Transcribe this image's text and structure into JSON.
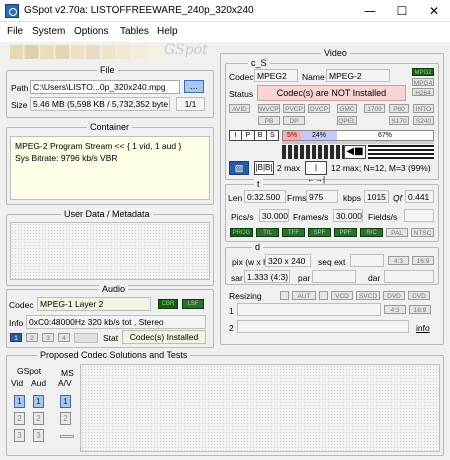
{
  "window": {
    "title": "GSpot v2.70a: LISTOFFREEWARE_240p_320x240",
    "minimize": "—",
    "maximize": "☐",
    "close": "✕"
  },
  "menu": [
    "File",
    "System",
    "Options",
    "Tables",
    "Help"
  ],
  "logo": "GSpot",
  "file": {
    "title": "File",
    "path_label": "Path",
    "path_value": "C:\\Users\\LISTO...0p_320x240.mpg",
    "browse": "...",
    "size_label": "Size",
    "size_value": "5.46 MB (5,598 KB / 5,732,352 byte",
    "page": "1/1"
  },
  "container": {
    "title": "Container",
    "line1": "MPEG-2 Program Stream << { 1 vid, 1 aud }",
    "line2": "Sys Bitrate: 9796 kb/s VBR"
  },
  "userdata": {
    "title": "User Data / Metadata"
  },
  "audio": {
    "title": "Audio",
    "codec_label": "Codec",
    "codec_value": "MPEG-1 Layer 2",
    "cbr": "CBR",
    "lsf": "LSF",
    "info_label": "Info",
    "info_value": "0xC0:48000Hz  320 kb/s tot , Stereo",
    "stat_label": "Stat",
    "stat_value": "Codec(s) Installed",
    "tracks": [
      "1",
      "2",
      "3",
      "4"
    ]
  },
  "video": {
    "title": "Video",
    "cs_label": "c_S",
    "codec_label": "Codec",
    "codec_value": "MPEG2",
    "name_label": "Name",
    "name_value": "MPEG-2",
    "status_label": "Status",
    "status_value": "Codec(s) are NOT Installed",
    "flags1": [
      "MPG2",
      "MPG4",
      "H264"
    ],
    "row_btns": [
      "AVID",
      "WVCP",
      "PVCP",
      "DVCP",
      "GMC",
      "1709",
      "P80",
      "INTO"
    ],
    "row_btns2": [
      "PB",
      "DP",
      "QPEL",
      "S170",
      "S240"
    ],
    "pbar": [
      "I",
      "P",
      "B",
      "S"
    ],
    "p_pct": "5%",
    "b_pct": "24%",
    "i_pct": "67%",
    "bmax": "2 max",
    "gop": "12 max; N=12, M=3 (99%)",
    "t_label": "t",
    "len_label": "Len",
    "len_value": "0:32.500",
    "frms_label": "Frms",
    "frms_value": "975",
    "kbps_label": "kbps",
    "kbps_value": "1015",
    "qf_label": "Qf",
    "qf_value": "0.441",
    "pics_label": "Pics/s",
    "pics_value": "30.000",
    "frames_label": "Frames/s",
    "frames_value": "30.000",
    "fields_label": "Fields/s",
    "fields_value": "",
    "scan": [
      "PROG",
      "T/L",
      "TFF",
      "SPF",
      "PPF",
      "R/C",
      "PAL",
      "NTSC"
    ],
    "d_label": "d",
    "pix_label": "pix (w x h)",
    "pix_value": "320 x 240",
    "seq_label": "seq ext",
    "aspect": [
      "4:3",
      "16:9"
    ],
    "sar_label": "sar",
    "sar_value": "1.333 (4:3)",
    "par_label": "par",
    "par_value": "",
    "dar_label": "dar",
    "dar_value": "",
    "resizing_label": "Resizing",
    "resize_btns": [
      "AUT",
      "VCD",
      "SVCD",
      "DVD",
      "DVD"
    ],
    "r1": "1",
    "r2": "2",
    "r1_btns": [
      "4:3",
      "16:9"
    ],
    "r2_btns": [
      "4:3",
      "16:9"
    ],
    "info": "info"
  },
  "proposed": {
    "title": "Proposed Codec Solutions and Tests",
    "gspot": "GSpot",
    "vid": "Vid",
    "aud": "Aud",
    "ms": "MS",
    "av": "A/V",
    "nums": [
      "1",
      "2",
      "3"
    ]
  }
}
